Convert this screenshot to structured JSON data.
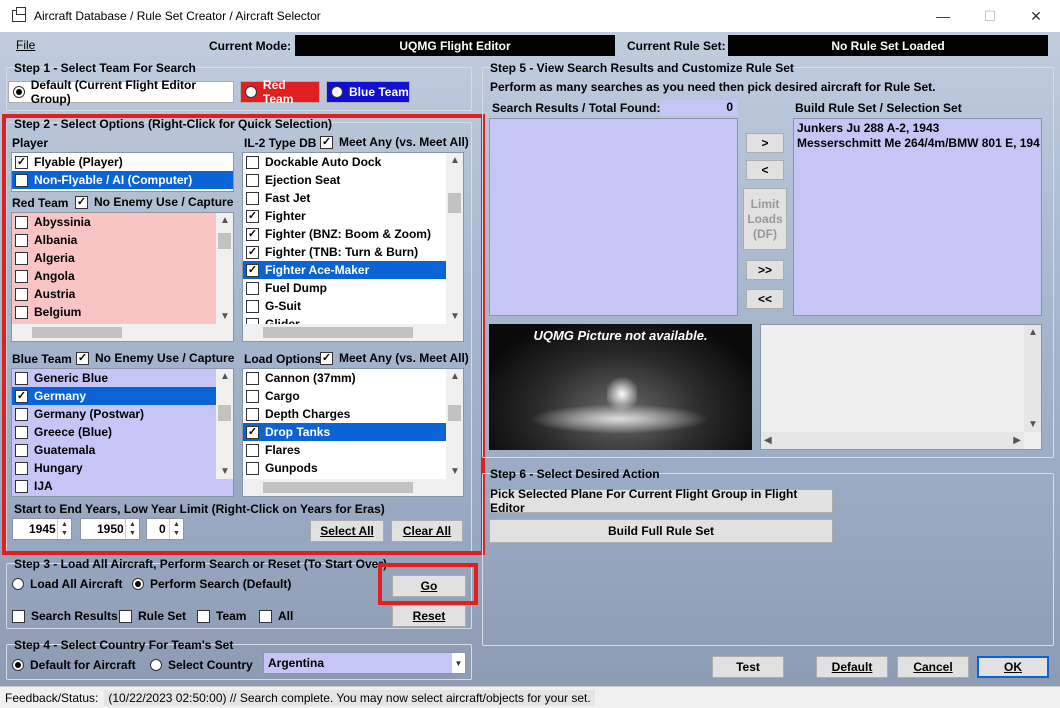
{
  "window": {
    "title": "Aircraft Database / Rule Set Creator / Aircraft Selector",
    "minimize": "—",
    "maximize": "☐",
    "close": "✕"
  },
  "menu": {
    "file": "File"
  },
  "mode": {
    "current_mode_label": "Current Mode:",
    "current_mode_value": "UQMG Flight Editor",
    "rule_set_label": "Current Rule Set:",
    "rule_set_value": "No Rule Set Loaded"
  },
  "step1": {
    "title": "Step 1 - Select Team For Search",
    "default_option": "Default (Current Flight Editor Group)",
    "red_team": "Red Team",
    "blue_team": "Blue Team"
  },
  "step2": {
    "title": "Step 2 - Select Options (Right-Click for Quick Selection)",
    "player_label": "Player",
    "player_items": [
      {
        "label": "Flyable (Player)",
        "checked": true,
        "selected": false
      },
      {
        "label": "Non-Flyable / AI (Computer)",
        "checked": false,
        "selected": true
      }
    ],
    "il2_label": "IL-2 Type DB",
    "meet_any_label": "Meet Any (vs. Meet All)",
    "type_items": [
      {
        "label": "Dockable Auto Dock",
        "checked": false,
        "selected": false
      },
      {
        "label": "Ejection Seat",
        "checked": false,
        "selected": false
      },
      {
        "label": "Fast Jet",
        "checked": false,
        "selected": false
      },
      {
        "label": "Fighter",
        "checked": true,
        "selected": false
      },
      {
        "label": "Fighter (BNZ: Boom & Zoom)",
        "checked": true,
        "selected": false
      },
      {
        "label": "Fighter (TNB: Turn & Burn)",
        "checked": true,
        "selected": false
      },
      {
        "label": "Fighter Ace-Maker",
        "checked": true,
        "selected": true
      },
      {
        "label": "Fuel Dump",
        "checked": false,
        "selected": false
      },
      {
        "label": "G-Suit",
        "checked": false,
        "selected": false
      },
      {
        "label": "Glider",
        "checked": false,
        "selected": false
      }
    ],
    "red_team_label": "Red Team",
    "no_enemy_label": "No Enemy Use / Capture",
    "red_items": [
      {
        "label": "Abyssinia",
        "checked": false
      },
      {
        "label": "Albania",
        "checked": false
      },
      {
        "label": "Algeria",
        "checked": false
      },
      {
        "label": "Angola",
        "checked": false
      },
      {
        "label": "Austria",
        "checked": false
      },
      {
        "label": "Belgium",
        "checked": false
      }
    ],
    "blue_team_label": "Blue Team",
    "blue_no_enemy_label": "No Enemy Use / Capture",
    "blue_items": [
      {
        "label": "Generic Blue",
        "checked": false,
        "selected": false
      },
      {
        "label": "Germany",
        "checked": true,
        "selected": true
      },
      {
        "label": "Germany (Postwar)",
        "checked": false,
        "selected": false
      },
      {
        "label": "Greece (Blue)",
        "checked": false,
        "selected": false
      },
      {
        "label": "Guatemala",
        "checked": false,
        "selected": false
      },
      {
        "label": "Hungary",
        "checked": false,
        "selected": false
      },
      {
        "label": "IJA",
        "checked": false,
        "selected": false
      }
    ],
    "load_options_label": "Load Options",
    "load_meet_any_label": "Meet Any (vs. Meet All)",
    "load_items": [
      {
        "label": "Cannon (37mm)",
        "checked": false,
        "selected": false
      },
      {
        "label": "Cargo",
        "checked": false,
        "selected": false
      },
      {
        "label": "Depth Charges",
        "checked": false,
        "selected": false
      },
      {
        "label": "Drop Tanks",
        "checked": true,
        "selected": true
      },
      {
        "label": "Flares",
        "checked": false,
        "selected": false
      },
      {
        "label": "Gunpods",
        "checked": false,
        "selected": false
      }
    ],
    "years_label": "Start to End Years, Low Year Limit (Right-Click on Years for Eras)",
    "start_year": "1945",
    "end_year": "1950",
    "low_limit": "0",
    "select_all": "Select All",
    "clear_all": "Clear All"
  },
  "step3": {
    "title": "Step 3 - Load All Aircraft, Perform Search or Reset (To Start Over)",
    "load_all": "Load All Aircraft",
    "perform_search": "Perform Search (Default)",
    "go": "Go",
    "reset": "Reset",
    "search_results": "Search Results",
    "rule_set": "Rule Set",
    "team": "Team",
    "all": "All"
  },
  "step4": {
    "title": "Step 4 - Select Country For Team's Set",
    "default_aircraft": "Default for Aircraft",
    "select_country": "Select Country",
    "country_value": "Argentina"
  },
  "step5": {
    "title": "Step 5 - View Search Results and Customize Rule Set",
    "instructions": "Perform as many searches as you need then pick desired aircraft for Rule Set.",
    "results_label": "Search Results / Total Found:",
    "results_count": "0",
    "build_label": "Build Rule Set / Selection  Set",
    "build_items": [
      "Junkers Ju 288 A-2, 1943",
      "Messerschmitt Me 264/4m/BMW 801 E, 194"
    ],
    "add": ">",
    "remove": "<",
    "limit_loads": "Limit Loads (DF)",
    "add_all": ">>",
    "remove_all": "<<",
    "picture_text": "UQMG Picture not available."
  },
  "step6": {
    "title": "Step 6 - Select Desired Action",
    "pick_plane": "Pick Selected Plane For Current Flight Group in Flight Editor",
    "build_full": "Build Full Rule Set"
  },
  "bottom": {
    "test": "Test",
    "default": "Default",
    "cancel": "Cancel",
    "ok": "OK"
  },
  "status": {
    "label": "Feedback/Status:",
    "text": "(10/22/2023 02:50:00) // Search complete. You may now select aircraft/objects for your set."
  },
  "colors": {
    "accent": "#0a64d6",
    "highlight_red": "#e02020",
    "list_purple": "#c6c6f6",
    "list_pink": "#f9c4c4",
    "red_team": "#e02020",
    "blue_team": "#1010d0"
  }
}
